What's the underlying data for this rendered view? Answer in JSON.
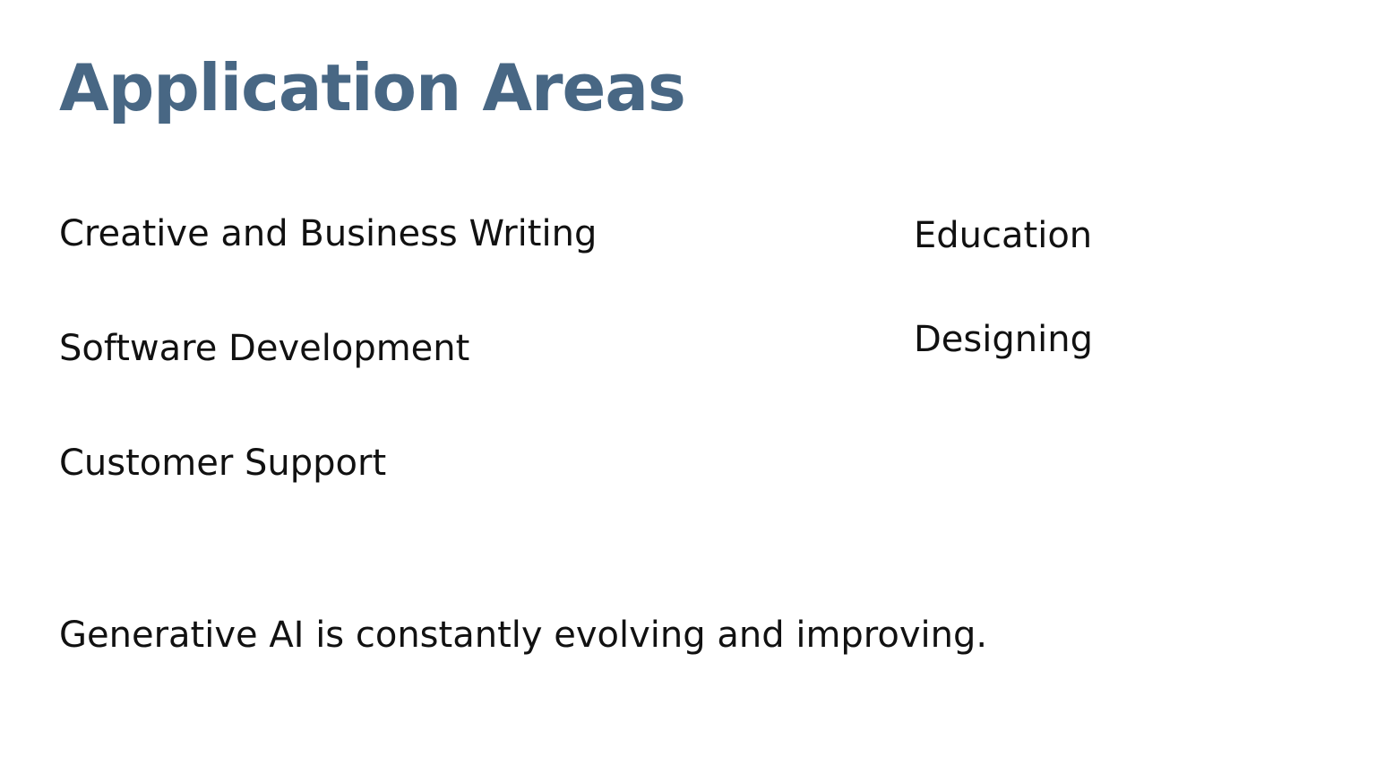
{
  "slide": {
    "title": "Application Areas",
    "left_items": [
      {
        "label": "Creative and Business Writing"
      },
      {
        "label": "Software Development"
      },
      {
        "label": "Customer Support"
      }
    ],
    "right_items": [
      {
        "label": "Education"
      },
      {
        "label": "Designing"
      }
    ],
    "footer_text": "Generative AI is constantly evolving and improving.",
    "colors": {
      "title": "#486784",
      "body_text": "#111111",
      "background": "#ffffff"
    }
  }
}
